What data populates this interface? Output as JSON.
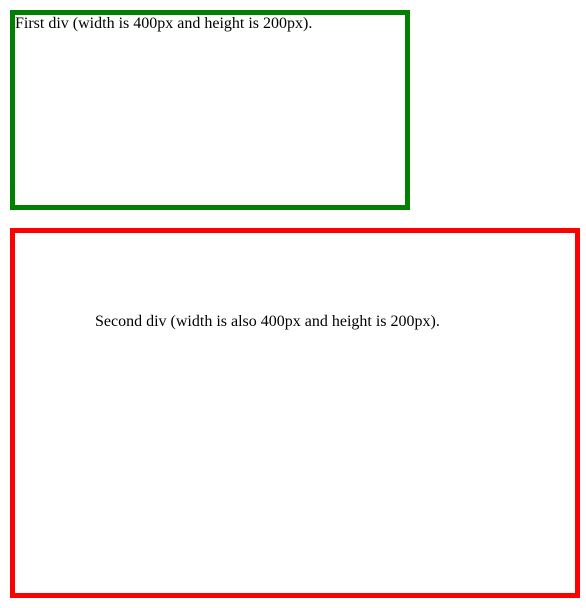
{
  "first_div": {
    "text": "First div (width is 400px and height is 200px)."
  },
  "second_div": {
    "text": "Second div (width is also 400px and height is 200px)."
  }
}
